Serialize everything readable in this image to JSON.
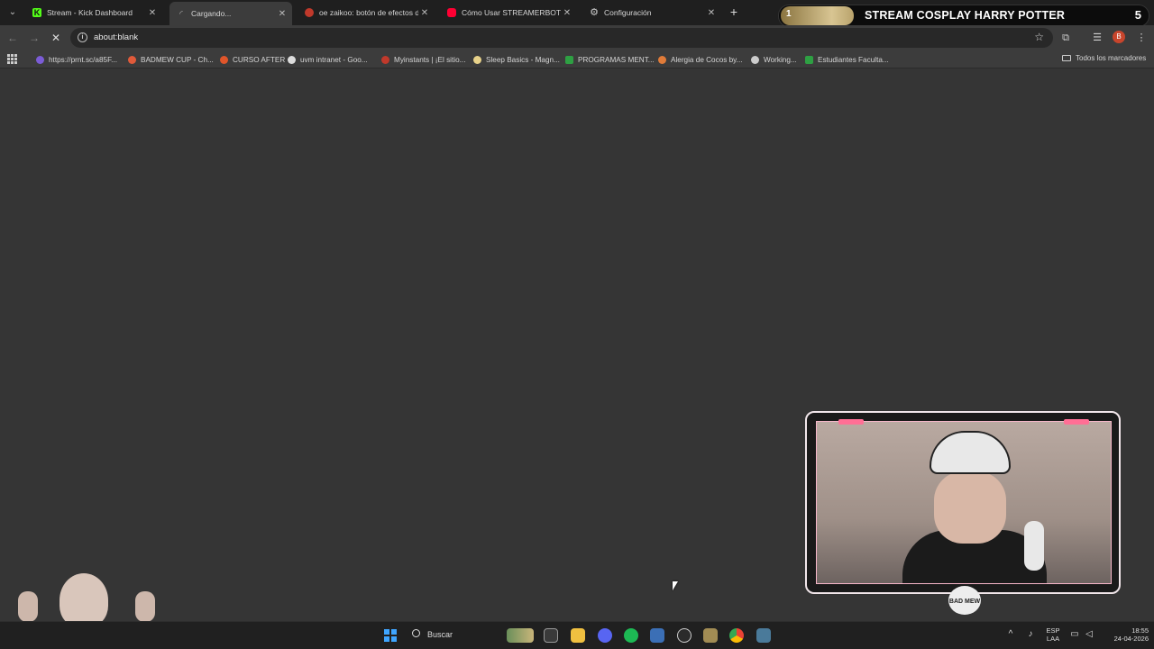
{
  "tabs": [
    {
      "label": "Stream - Kick Dashboard",
      "icon": "kick-icon",
      "color": "#53fc18"
    },
    {
      "label": "Cargando...",
      "icon": "loading-icon",
      "color": "#888888",
      "active": true
    },
    {
      "label": "oe zaikoo: botón de efectos de",
      "icon": "myinstants-icon",
      "color": "#c0392b"
    },
    {
      "label": "Cómo Usar STREAMERBOT De",
      "icon": "youtube-icon",
      "color": "#ff0033"
    },
    {
      "label": "Configuración",
      "icon": "gear-icon",
      "color": "#cccccc"
    }
  ],
  "banner": {
    "number": "1",
    "title": "STREAM COSPLAY HARRY POTTER",
    "right": "5"
  },
  "address": {
    "url": "about:blank"
  },
  "profile_initial": "B",
  "bookmarks": [
    {
      "label": "https://prnt.sc/a85F...",
      "color": "#7b5cd6"
    },
    {
      "label": "BADMEW CUP - Ch...",
      "color": "#e05a3a"
    },
    {
      "label": "CURSO AFTER",
      "color": "#e0552a"
    },
    {
      "label": "uvm intranet - Goo...",
      "color": "#dddddd"
    },
    {
      "label": "Myinstants | ¡El sitio...",
      "color": "#c0392b"
    },
    {
      "label": "Sleep Basics - Magn...",
      "color": "#e8d28a"
    },
    {
      "label": "PROGRAMAS MENT...",
      "color": "#2ea043"
    },
    {
      "label": "Alergia de Cocos by...",
      "color": "#e07b39"
    },
    {
      "label": "Working...",
      "color": "#cccccc"
    },
    {
      "label": "Estudiantes Faculta...",
      "color": "#2ea043"
    }
  ],
  "bookmarks_all": "Todos los marcadores",
  "webcam_logo": "BAD MEW",
  "taskbar": {
    "search_label": "Buscar",
    "lang_line1": "ESP",
    "lang_line2": "LAA",
    "time": "18:55",
    "date": "24-04-2026"
  }
}
